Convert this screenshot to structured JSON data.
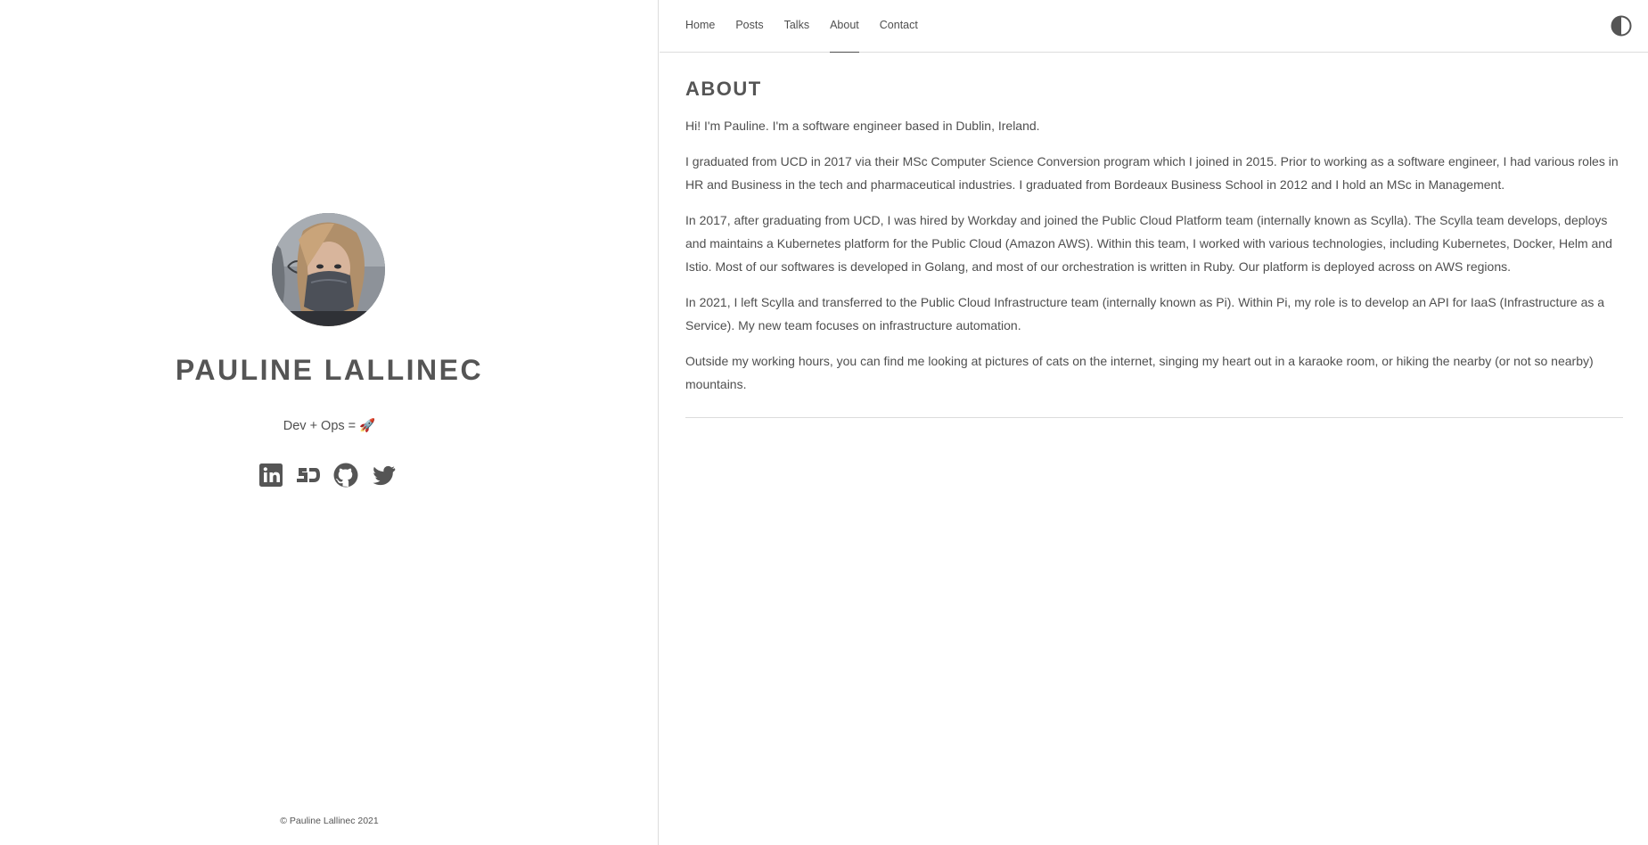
{
  "profile": {
    "name": "PAULINE LALLINEC",
    "tagline": "Dev + Ops = 🚀",
    "socials": [
      {
        "icon": "linkedin-icon",
        "label": "LinkedIn"
      },
      {
        "icon": "sourcehut-icon",
        "label": "SJ"
      },
      {
        "icon": "github-icon",
        "label": "GitHub"
      },
      {
        "icon": "twitter-icon",
        "label": "Twitter"
      }
    ],
    "copyright": "© Pauline Lallinec 2021"
  },
  "nav": {
    "items": [
      {
        "label": "Home"
      },
      {
        "label": "Posts"
      },
      {
        "label": "Talks"
      },
      {
        "label": "About",
        "active": true
      },
      {
        "label": "Contact"
      }
    ],
    "theme_toggle_icon": "contrast-icon"
  },
  "page": {
    "title": "ABOUT",
    "paragraphs": [
      "Hi! I'm Pauline. I'm a software engineer based in Dublin, Ireland.",
      "I graduated from UCD in 2017 via their MSc Computer Science Conversion program which I joined in 2015. Prior to working as a software engineer, I had various roles in HR and Business in the tech and pharmaceutical industries. I graduated from Bordeaux Business School in 2012 and I hold an MSc in Management.",
      "In 2017, after graduating from UCD, I was hired by Workday and joined the Public Cloud Platform team (internally known as Scylla). The Scylla team develops, deploys and maintains a Kubernetes platform for the Public Cloud (Amazon AWS). Within this team, I worked with various technologies, including Kubernetes, Docker, Helm and Istio. Most of our softwares is developed in Golang, and most of our orchestration is written in Ruby. Our platform is deployed across on AWS regions.",
      "In 2021, I left Scylla and transferred to the Public Cloud Infrastructure team (internally known as Pi). Within Pi, my role is to develop an API for IaaS (Infrastructure as a Service). My new team focuses on infrastructure automation.",
      "Outside my working hours, you can find me looking at pictures of cats on the internet, singing my heart out in a karaoke room, or hiking the nearby (or not so nearby) mountains."
    ]
  },
  "colors": {
    "text": "#4f4f4f",
    "border": "#dcdcdc",
    "background": "#ffffff"
  }
}
